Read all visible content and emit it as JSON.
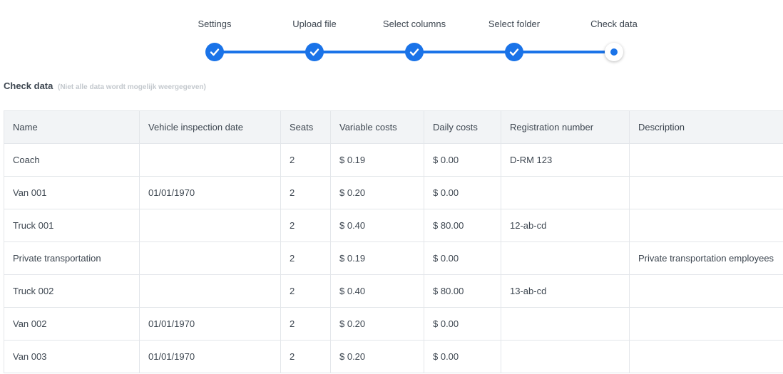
{
  "stepper": {
    "steps": [
      {
        "label": "Settings",
        "status": "done"
      },
      {
        "label": "Upload file",
        "status": "done"
      },
      {
        "label": "Select columns",
        "status": "done"
      },
      {
        "label": "Select folder",
        "status": "done"
      },
      {
        "label": "Check data",
        "status": "current"
      }
    ],
    "accent_color": "#1a73e8"
  },
  "section": {
    "title": "Check data",
    "note": "(Niet alle data wordt mogelijk weergegeven)"
  },
  "table": {
    "columns": [
      "Name",
      "Vehicle inspection date",
      "Seats",
      "Variable costs",
      "Daily costs",
      "Registration number",
      "Description"
    ],
    "rows": [
      [
        "Coach",
        "",
        "2",
        "$ 0.19",
        "$ 0.00",
        "D-RM 123",
        ""
      ],
      [
        "Van 001",
        "01/01/1970",
        "2",
        "$ 0.20",
        "$ 0.00",
        "",
        ""
      ],
      [
        "Truck 001",
        "",
        "2",
        "$ 0.40",
        "$ 80.00",
        "12-ab-cd",
        ""
      ],
      [
        "Private transportation",
        "",
        "2",
        "$ 0.19",
        "$ 0.00",
        "",
        "Private transportation employees"
      ],
      [
        "Truck 002",
        "",
        "2",
        "$ 0.40",
        "$ 80.00",
        "13-ab-cd",
        ""
      ],
      [
        "Van 002",
        "01/01/1970",
        "2",
        "$ 0.20",
        "$ 0.00",
        "",
        ""
      ],
      [
        "Van 003",
        "01/01/1970",
        "2",
        "$ 0.20",
        "$ 0.00",
        "",
        ""
      ]
    ]
  }
}
